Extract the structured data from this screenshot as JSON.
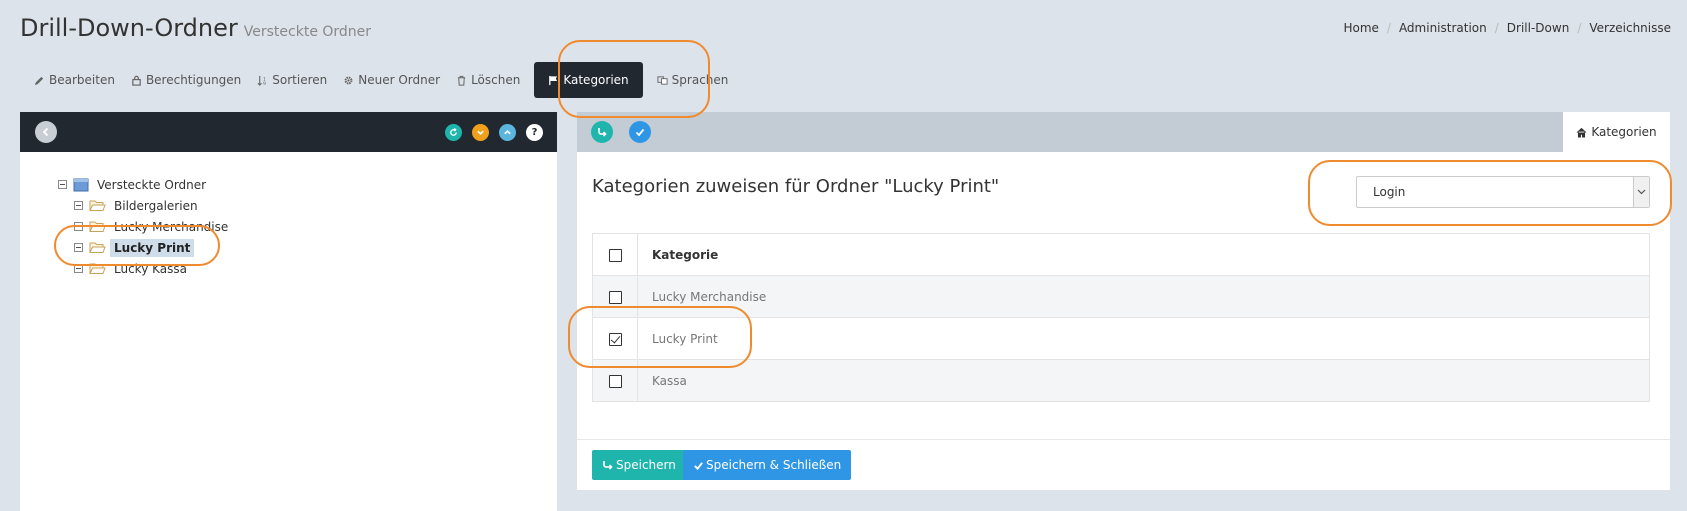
{
  "header": {
    "title": "Drill-Down-Ordner",
    "subtitle": "Versteckte Ordner"
  },
  "breadcrumb": [
    "Home",
    "Administration",
    "Drill-Down",
    "Verzeichnisse"
  ],
  "toolbar": {
    "edit": "Bearbeiten",
    "permissions": "Berechtigungen",
    "sort": "Sortieren",
    "new_folder": "Neuer Ordner",
    "delete": "Löschen",
    "categories": "Kategorien",
    "languages": "Sprachen"
  },
  "tree": {
    "root": "Versteckte Ordner",
    "children": [
      "Bildergalerien",
      "Lucky Merchandise",
      "Lucky Print",
      "Lucky Kassa"
    ],
    "selected": "Lucky Print"
  },
  "right_panel": {
    "tab_label": "Kategorien",
    "content_title": "Kategorien zuweisen für Ordner \"Lucky Print\"",
    "select_value": "Login",
    "table_header": "Kategorie",
    "rows": [
      {
        "label": "Lucky Merchandise",
        "checked": false
      },
      {
        "label": "Lucky Print",
        "checked": true
      },
      {
        "label": "Kassa",
        "checked": false
      }
    ],
    "save_label": "Speichern",
    "save_close_label": "Speichern & Schließen"
  },
  "colors": {
    "dark_header": "#222830",
    "teal": "#1fb5ac",
    "blue": "#2f96e6",
    "orange_highlight": "#ef8a2e",
    "selected_bg": "#cfdcea"
  }
}
